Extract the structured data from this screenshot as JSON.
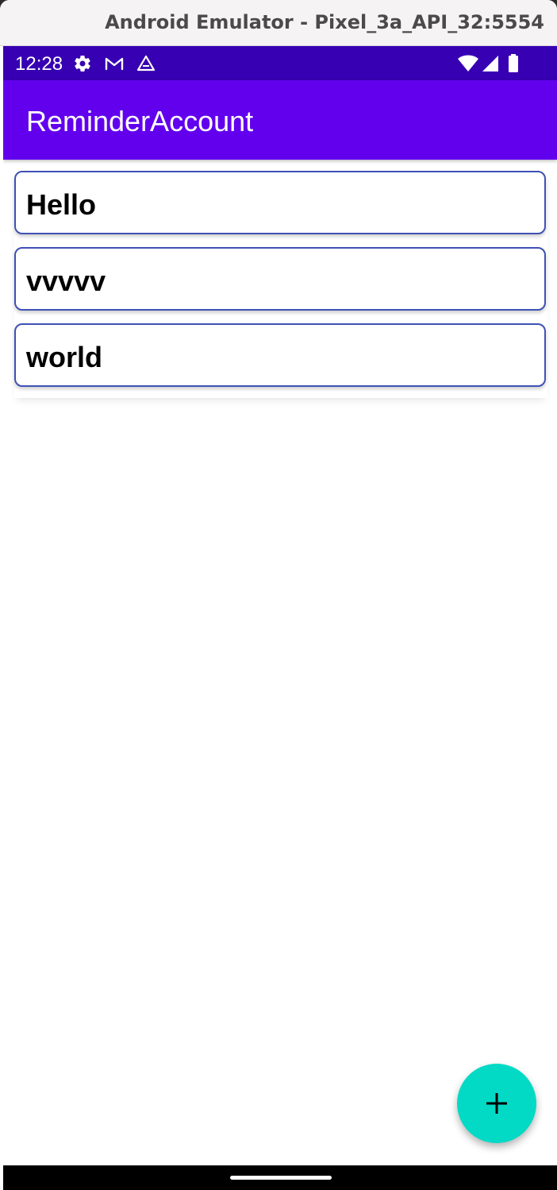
{
  "window": {
    "title": "Android Emulator - Pixel_3a_API_32:5554"
  },
  "status_bar": {
    "time": "12:28",
    "left_icons": [
      "gear-icon",
      "gmail-icon",
      "drive-icon"
    ],
    "right_icons": [
      "wifi-icon",
      "signal-icon",
      "battery-icon"
    ],
    "background": "#3700b3"
  },
  "app_bar": {
    "title": "ReminderAccount",
    "background": "#6200ee"
  },
  "list": {
    "items": [
      {
        "label": "Hello"
      },
      {
        "label": "vvvvv"
      },
      {
        "label": "world"
      }
    ],
    "border_color": "#3f51b5"
  },
  "fab": {
    "icon": "plus-icon",
    "background": "#03dac5"
  }
}
